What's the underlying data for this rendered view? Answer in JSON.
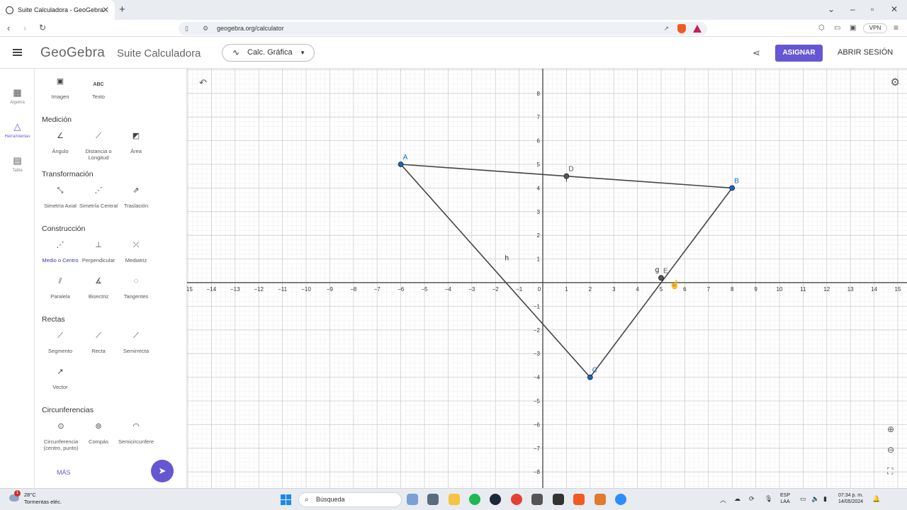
{
  "browser": {
    "tab_title": "Suite Calculadora - GeoGebra",
    "url": "geogebra.org/calculator",
    "vpn_label": "VPN"
  },
  "app": {
    "logo": "GeoGebra",
    "suite_title": "Suite Calculadora",
    "calc_select": "Calc. Gráfica",
    "assign_label": "ASIGNAR",
    "login_label": "ABRIR SESIÓN"
  },
  "rail": {
    "algebra": "Algebra",
    "tools": "Herramientas",
    "table": "Tabla"
  },
  "tools": {
    "top": [
      "Imagen",
      "Texto"
    ],
    "abc_icon": "ABC",
    "sections": {
      "measure": "Medición",
      "transform": "Transformación",
      "construct": "Construcción",
      "lines": "Rectas",
      "circles": "Circunferencias"
    },
    "measure": [
      "Ángulo",
      "Distancia o Longitud",
      "Área"
    ],
    "transform": [
      "Simetría Axial",
      "Simetría Central",
      "Traslación"
    ],
    "construct": [
      "Medio o Centro",
      "Perpendicular",
      "Mediatriz",
      "Paralela",
      "Bisectriz",
      "Tangentes"
    ],
    "lines": [
      "Segmento",
      "Recta",
      "Semirrecta",
      "Vector"
    ],
    "circles": [
      "Circunferencia (centro, punto)",
      "Compás",
      "Semicircunfere"
    ],
    "more": "MÁS"
  },
  "graph": {
    "x_range": [
      -15,
      15
    ],
    "y_range": [
      -8,
      8
    ],
    "x_labels": [
      "−15",
      "−14",
      "−13",
      "−12",
      "−11",
      "−10",
      "−9",
      "−8",
      "−7",
      "−6",
      "−5",
      "−4",
      "−3",
      "−2",
      "−1",
      "0",
      "1",
      "2",
      "3",
      "4",
      "5",
      "6",
      "7",
      "8",
      "9",
      "10",
      "11",
      "12",
      "13",
      "14",
      "15"
    ],
    "y_labels": [
      "8",
      "7",
      "6",
      "5",
      "4",
      "3",
      "2",
      "1",
      "−1",
      "−2",
      "−3",
      "−4",
      "−5",
      "−6",
      "−7",
      "−8"
    ],
    "points": [
      {
        "name": "A",
        "x": -6,
        "y": 5
      },
      {
        "name": "B",
        "x": 8,
        "y": 4
      },
      {
        "name": "C",
        "x": 2,
        "y": -4
      },
      {
        "name": "D",
        "x": 1,
        "y": 4.5
      },
      {
        "name": "E",
        "x": 5,
        "y": 0.2
      }
    ],
    "segment_labels": [
      "h",
      "g"
    ],
    "colors": {
      "point": "#1565c0",
      "segment": "#444444",
      "grid_major": "#cccccc",
      "grid_minor": "#eeeeee",
      "accent": "#6557d2"
    }
  },
  "taskbar": {
    "temperature": "28°C",
    "weather": "Tormentas eléc.",
    "notification_count": "1",
    "search_placeholder": "Búsqueda",
    "lang_1": "ESP",
    "lang_2": "LAA",
    "time": "07:34 p. m.",
    "date": "14/05/2024"
  }
}
